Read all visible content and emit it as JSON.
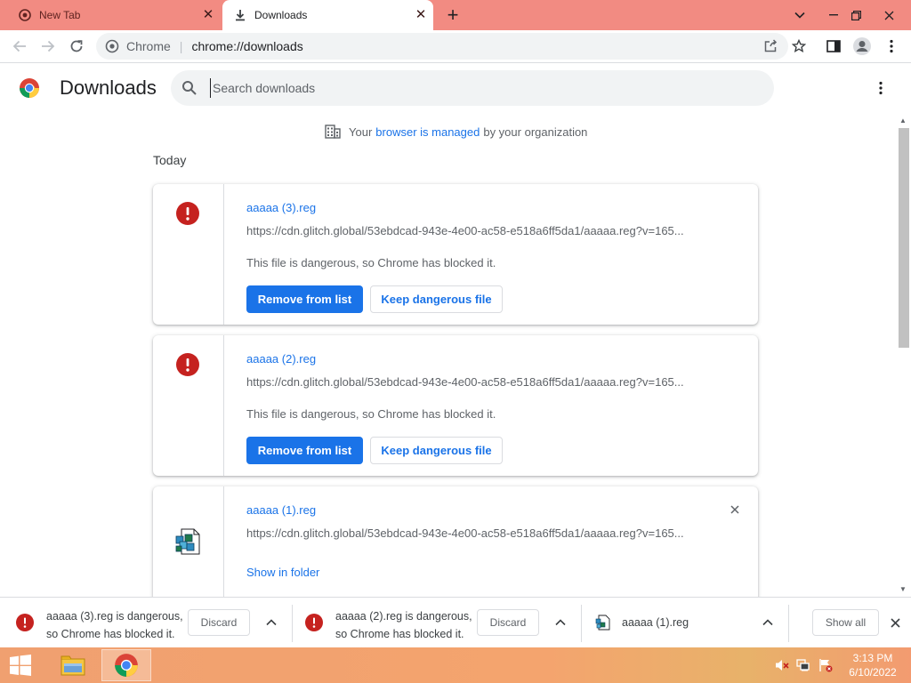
{
  "tabs": [
    {
      "title": "New Tab",
      "active": false
    },
    {
      "title": "Downloads",
      "active": true
    }
  ],
  "omnibox": {
    "site_label": "Chrome",
    "url": "chrome://downloads"
  },
  "page": {
    "title": "Downloads",
    "search_placeholder": "Search downloads",
    "managed": {
      "prefix": "Your",
      "link": "browser is managed",
      "suffix": "by your organization"
    },
    "section_date": "Today"
  },
  "downloads": [
    {
      "name": "aaaaa (3).reg",
      "url": "https://cdn.glitch.global/53ebdcad-943e-4e00-ac58-e518a6ff5da1/aaaaa.reg?v=165...",
      "message": "This file is dangerous, so Chrome has blocked it.",
      "primary_button": "Remove from list",
      "secondary_button": "Keep dangerous file"
    },
    {
      "name": "aaaaa (2).reg",
      "url": "https://cdn.glitch.global/53ebdcad-943e-4e00-ac58-e518a6ff5da1/aaaaa.reg?v=165...",
      "message": "This file is dangerous, so Chrome has blocked it.",
      "primary_button": "Remove from list",
      "secondary_button": "Keep dangerous file"
    },
    {
      "name": "aaaaa (1).reg",
      "url": "https://cdn.glitch.global/53ebdcad-943e-4e00-ac58-e518a6ff5da1/aaaaa.reg?v=165...",
      "action_link": "Show in folder"
    }
  ],
  "shelf": {
    "items": [
      {
        "line1": "aaaaa (3).reg is dangerous,",
        "line2": "so Chrome has blocked it.",
        "button": "Discard"
      },
      {
        "line1": "aaaaa (2).reg is dangerous,",
        "line2": "so Chrome has blocked it.",
        "button": "Discard"
      },
      {
        "name": "aaaaa (1).reg"
      }
    ],
    "show_all": "Show all"
  },
  "taskbar": {
    "time": "3:13 PM",
    "date": "6/10/2022"
  },
  "colors": {
    "accent": "#1a73e8",
    "danger": "#c5221f",
    "tabstrip": "#f28b82"
  }
}
